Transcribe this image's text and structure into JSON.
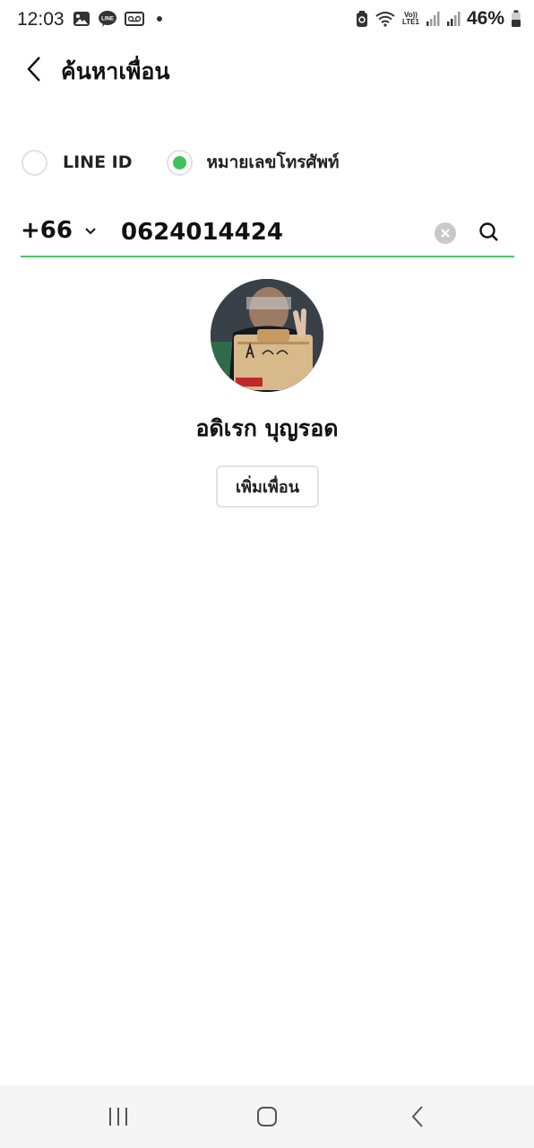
{
  "status_bar": {
    "time": "12:03",
    "lte_top": "Vo))",
    "lte_bottom": "LTE1",
    "battery": "46%"
  },
  "header": {
    "title": "ค้นหาเพื่อน"
  },
  "search_type": {
    "options": [
      {
        "label": "LINE ID",
        "selected": false
      },
      {
        "label": "หมายเลขโทรศัพท์",
        "selected": true
      }
    ]
  },
  "search": {
    "country_code": "+66",
    "value": "0624014424"
  },
  "result": {
    "name": "อดิเรก บุญรอด",
    "add_button": "เพิ่มเพื่อน"
  },
  "colors": {
    "accent": "#4cc764",
    "radio_selected": "#3fc15c"
  }
}
